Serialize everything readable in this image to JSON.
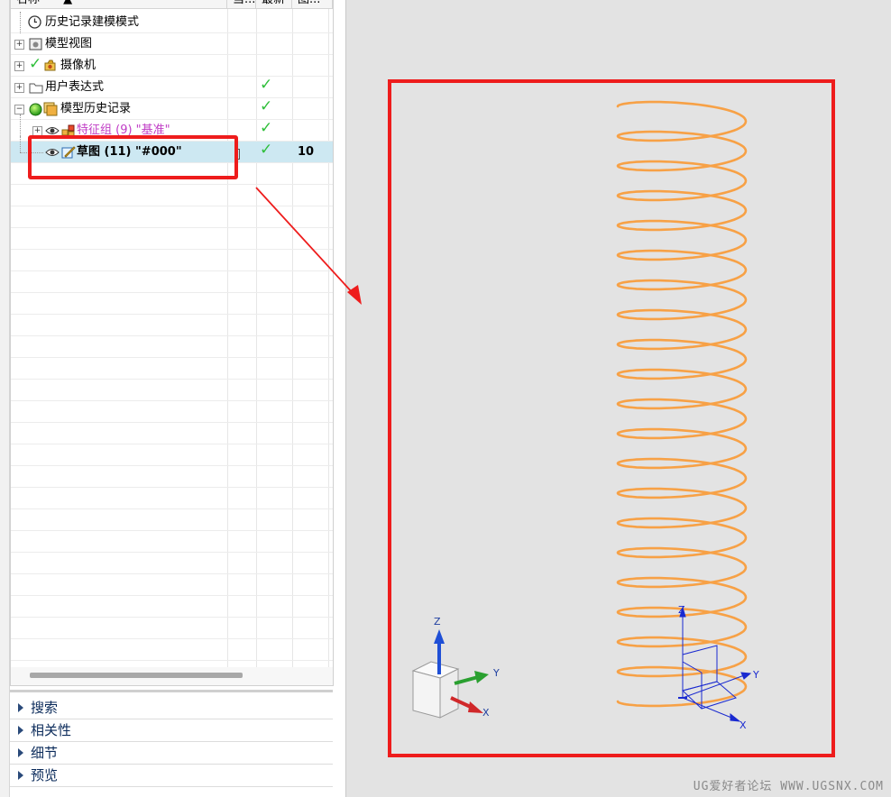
{
  "columns": {
    "name": "名称",
    "current": "当...",
    "latest": "最新",
    "layer": "图..."
  },
  "tree": {
    "items": [
      {
        "label": "历史记录建模模式",
        "icon": "clock-icon"
      },
      {
        "label": "模型视图",
        "icon": "model-view-icon"
      },
      {
        "label": "摄像机",
        "icon": "camera-icon"
      },
      {
        "label": "用户表达式",
        "icon": "folder-icon"
      },
      {
        "label": "模型历史记录",
        "icon": "history-icon"
      },
      {
        "label": "特征组 (9) \"基准\"",
        "icon": "feature-group-icon"
      },
      {
        "label": "草图 (11) \"#000\"",
        "icon": "sketch-icon",
        "layer": "10"
      }
    ]
  },
  "panels": [
    "搜索",
    "相关性",
    "细节",
    "预览"
  ],
  "triad": {
    "z": "Z",
    "y": "Y",
    "x": "X"
  },
  "csys": {
    "z": "Z",
    "y": "Y",
    "x": "X"
  },
  "watermark": "UG爱好者论坛 WWW.UGSNX.COM",
  "colors": {
    "spring": "#f7a146",
    "highlight": "#ee1c1c",
    "selected_row": "#cde8f2",
    "check": "#2fbf3a"
  }
}
